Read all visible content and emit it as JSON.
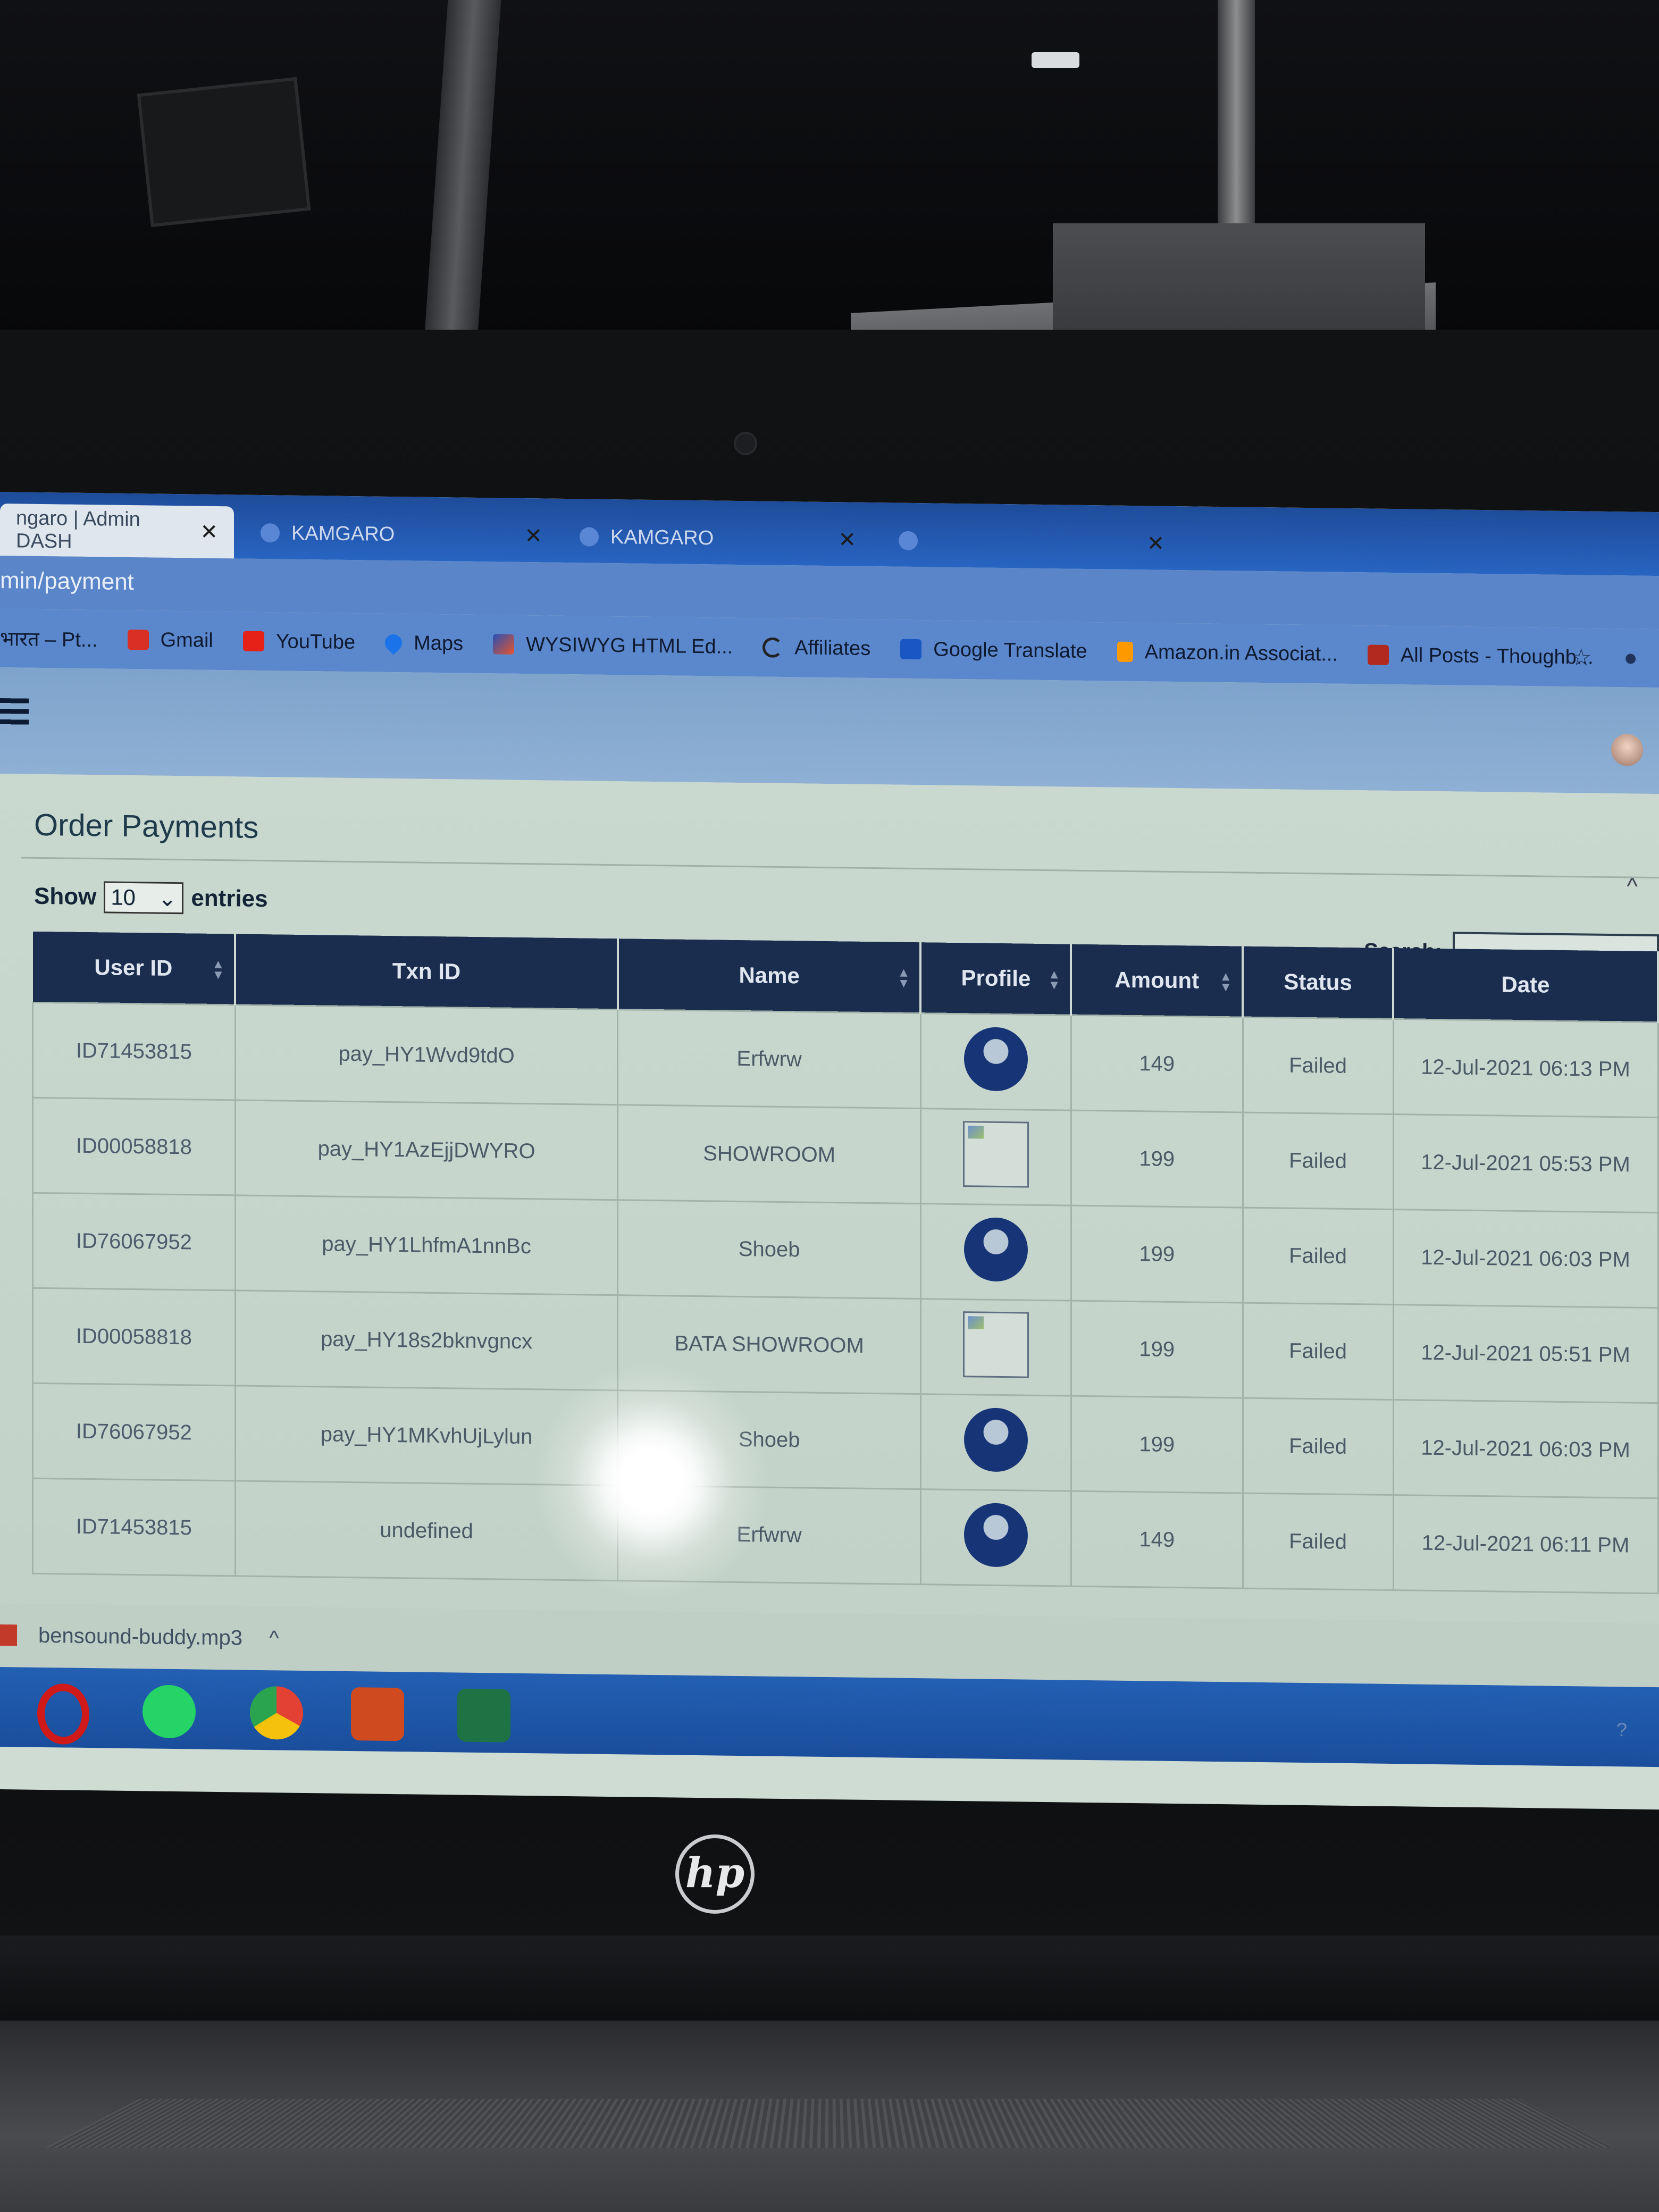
{
  "browser": {
    "tabs": [
      {
        "title": "ngaro | Admin DASH",
        "active": true
      },
      {
        "title": "KAMGARO",
        "active": false
      },
      {
        "title": "KAMGARO",
        "active": false
      },
      {
        "title": "",
        "active": false
      }
    ],
    "url": "min/payment",
    "bookmarks": [
      {
        "label": "भारत – Pt...",
        "icon": "bookmark-icon",
        "color": "#c0392b"
      },
      {
        "label": "Gmail",
        "icon": "gmail-icon",
        "color": "#d93025"
      },
      {
        "label": "YouTube",
        "icon": "youtube-icon",
        "color": "#e62117"
      },
      {
        "label": "Maps",
        "icon": "maps-pin-icon",
        "color": "#1a73e8"
      },
      {
        "label": "WYSIWYG HTML Ed...",
        "icon": "editor-icon",
        "color": "#e8552d"
      },
      {
        "label": "Affiliates",
        "icon": "affiliates-icon",
        "color": "#222222"
      },
      {
        "label": "Google Translate",
        "icon": "translate-icon",
        "color": "#1a56c4"
      },
      {
        "label": "Amazon.in Associat...",
        "icon": "amazon-icon",
        "color": "#ff9900"
      },
      {
        "label": "All Posts - Thoughb...",
        "icon": "posts-icon",
        "color": "#b22a1f"
      }
    ]
  },
  "page": {
    "title": "Order Payments",
    "show_label": "Show",
    "entries_value": "10",
    "entries_label": "entries",
    "search_label": "Search:",
    "search_value": ""
  },
  "table": {
    "columns": [
      "User ID",
      "Txn ID",
      "Name",
      "Profile",
      "Amount",
      "Status",
      "Date"
    ],
    "rows": [
      {
        "user_id": "ID71453815",
        "txn_id": "pay_HY1Wvd9tdO",
        "name": "Erfwrw",
        "profile": "avatar",
        "amount": "149",
        "status": "Failed",
        "date": "12-Jul-2021 06:13 PM"
      },
      {
        "user_id": "ID00058818",
        "txn_id": "pay_HY1AzEjjDWYRO",
        "name": "SHOWROOM",
        "profile": "broken-image",
        "amount": "199",
        "status": "Failed",
        "date": "12-Jul-2021 05:53 PM"
      },
      {
        "user_id": "ID76067952",
        "txn_id": "pay_HY1LhfmA1nnBc",
        "name": "Shoeb",
        "profile": "avatar",
        "amount": "199",
        "status": "Failed",
        "date": "12-Jul-2021 06:03 PM"
      },
      {
        "user_id": "ID00058818",
        "txn_id": "pay_HY18s2bknvgncx",
        "name": "BATA SHOWROOM",
        "profile": "broken-image",
        "amount": "199",
        "status": "Failed",
        "date": "12-Jul-2021 05:51 PM"
      },
      {
        "user_id": "ID76067952",
        "txn_id": "pay_HY1MKvhUjLylun",
        "name": "Shoeb",
        "profile": "avatar",
        "amount": "199",
        "status": "Failed",
        "date": "12-Jul-2021 06:03 PM"
      },
      {
        "user_id": "ID71453815",
        "txn_id": "undefined",
        "name": "Erfwrw",
        "profile": "avatar",
        "amount": "149",
        "status": "Failed",
        "date": "12-Jul-2021 06:11 PM"
      }
    ]
  },
  "downloads": {
    "file": "bensound-buddy.mp3"
  },
  "taskbar": {
    "apps": [
      {
        "name": "opera-icon",
        "color": "#d01a1a"
      },
      {
        "name": "whatsapp-icon",
        "color": "#25d366"
      },
      {
        "name": "chrome-icon",
        "color": "#e34133"
      },
      {
        "name": "presentation-icon",
        "color": "#d04a1f"
      },
      {
        "name": "excel-icon",
        "color": "#1f7244"
      }
    ]
  },
  "laptop_logo": "hp"
}
